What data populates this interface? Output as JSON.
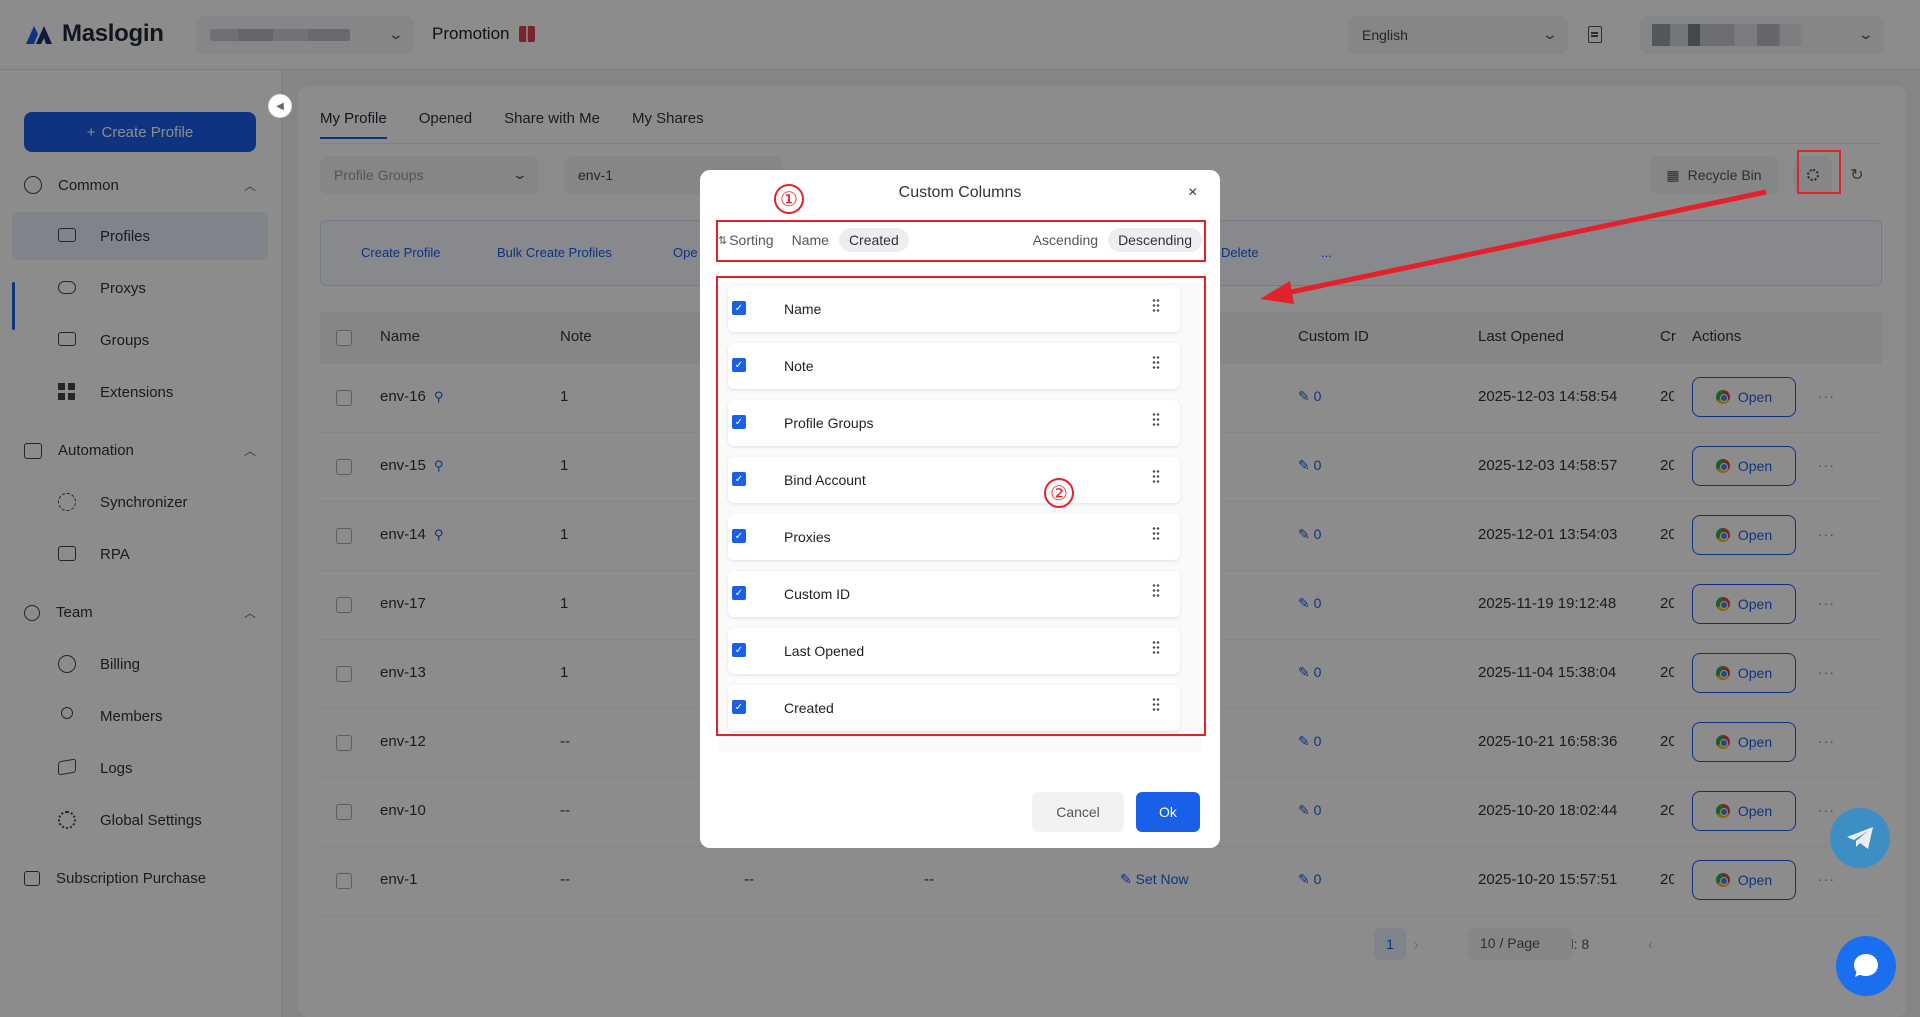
{
  "app": {
    "logo_text": "Maslogin",
    "promotion_label": "Promotion",
    "language": "English"
  },
  "sidebar": {
    "create_profile": "Create Profile",
    "sections": [
      {
        "label": "Common",
        "items": [
          "Profiles",
          "Proxys",
          "Groups",
          "Extensions"
        ]
      },
      {
        "label": "Automation",
        "items": [
          "Synchronizer",
          "RPA"
        ]
      },
      {
        "label": "Team",
        "items": [
          "Billing",
          "Members",
          "Logs",
          "Global Settings"
        ]
      }
    ],
    "subscription": "Subscription Purchase"
  },
  "tabs": [
    "My Profile",
    "Opened",
    "Share with Me",
    "My Shares"
  ],
  "filters": {
    "groups_placeholder": "Profile Groups",
    "search_value": "env-1"
  },
  "toolbar": {
    "recycle_bin": "Recycle Bin"
  },
  "actionbar": [
    "Create Profile",
    "Bulk Create Profiles",
    "Ope",
    "Delete",
    "..."
  ],
  "table": {
    "headers": {
      "name": "Name",
      "note": "Note",
      "custom_id": "Custom ID",
      "last_opened": "Last Opened",
      "created": "Cr",
      "actions": "Actions"
    },
    "rows": [
      {
        "name": "env-16",
        "pinned": true,
        "note": "1",
        "custom_id": "0",
        "last_opened": "2025-12-03 14:58:54",
        "created": "20"
      },
      {
        "name": "env-15",
        "pinned": true,
        "note": "1",
        "custom_id": "0",
        "last_opened": "2025-12-03 14:58:57",
        "created": "20"
      },
      {
        "name": "env-14",
        "pinned": true,
        "note": "1",
        "custom_id": "0",
        "last_opened": "2025-12-01 13:54:03",
        "created": "20"
      },
      {
        "name": "env-17",
        "pinned": false,
        "note": "1",
        "custom_id": "0",
        "last_opened": "2025-11-19 19:12:48",
        "created": "20"
      },
      {
        "name": "env-13",
        "pinned": false,
        "note": "1",
        "custom_id": "0",
        "last_opened": "2025-11-04 15:38:04",
        "created": "20"
      },
      {
        "name": "env-12",
        "pinned": false,
        "note": "--",
        "custom_id": "0",
        "last_opened": "2025-10-21 16:58:36",
        "created": "20"
      },
      {
        "name": "env-10",
        "pinned": false,
        "note": "--",
        "custom_id": "0",
        "last_opened": "2025-10-20 18:02:44",
        "created": "20"
      },
      {
        "name": "env-1",
        "pinned": false,
        "note": "--",
        "groups": "--",
        "bind": "--",
        "proxy": "Set Now",
        "custom_id": "0",
        "last_opened": "2025-10-20 15:57:51",
        "created": "20"
      }
    ],
    "open_label": "Open",
    "more_label": "···"
  },
  "pagination": {
    "total": "Total: 8",
    "current_page": "1",
    "per_page": "10 / Page"
  },
  "modal": {
    "title": "Custom Columns",
    "close": "×",
    "sorting_label": "Sorting",
    "sort_fields": [
      "Name",
      "Created"
    ],
    "sort_field_selected": "Created",
    "sort_orders": [
      "Ascending",
      "Descending"
    ],
    "sort_order_selected": "Descending",
    "columns": [
      {
        "label": "Name",
        "checked": true
      },
      {
        "label": "Note",
        "checked": true
      },
      {
        "label": "Profile Groups",
        "checked": true
      },
      {
        "label": "Bind Account",
        "checked": true
      },
      {
        "label": "Proxies",
        "checked": true
      },
      {
        "label": "Custom ID",
        "checked": true
      },
      {
        "label": "Last Opened",
        "checked": true
      },
      {
        "label": "Created",
        "checked": true
      }
    ],
    "cancel": "Cancel",
    "ok": "Ok"
  },
  "annotations": {
    "marker_1": "①",
    "marker_2": "②"
  },
  "colors": {
    "accent": "#1a5fe8",
    "annotation_red": "#e3212b"
  }
}
